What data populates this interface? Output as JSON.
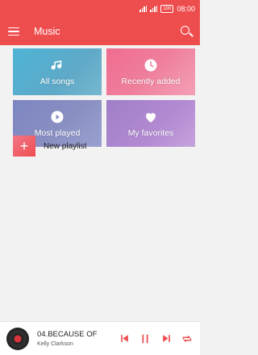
{
  "status_bar": {
    "battery_label": "100",
    "time": "08:00"
  },
  "app_bar": {
    "title": "Music",
    "menu_icon": "hamburger-menu-icon",
    "search_icon": "search-icon"
  },
  "tiles": [
    {
      "label": "All songs",
      "icon": "music-note-icon"
    },
    {
      "label": "Recently added",
      "icon": "clock-icon"
    },
    {
      "label": "Most played",
      "icon": "play-circle-icon"
    },
    {
      "label": "My favorites",
      "icon": "heart-icon"
    }
  ],
  "new_playlist": {
    "label": "New playlist",
    "icon": "plus-icon"
  },
  "now_playing": {
    "title": "04.BECAUSE OF",
    "artist": "Kelly Clarkson",
    "controls": [
      "previous-icon",
      "pause-icon",
      "next-icon",
      "repeat-icon"
    ]
  },
  "colors": {
    "accent": "#ee4d4e"
  }
}
